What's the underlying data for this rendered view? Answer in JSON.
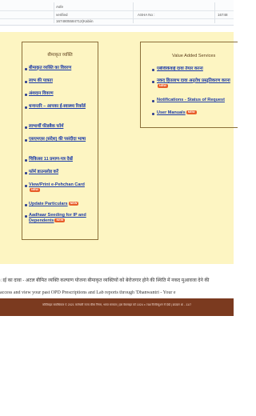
{
  "top_table": {
    "row1_col1": "",
    "row1_col2": "Asfe",
    "row1_col3": "",
    "row2_col1": "",
    "row2_col2": "verified",
    "row2_col3": "ASHA No :",
    "row2_col4": "16748",
    "row3_col2": "1674805584712(Kabiin"
  },
  "left_box": {
    "title": "बीमाकृत व्यक्ति",
    "items": [
      {
        "label": "बीमाकृत व्यक्ति का विवरण"
      },
      {
        "label": "लाभ की पात्रता"
      },
      {
        "label": "अंशदान विवरण"
      },
      {
        "label": "धन्वन्तरि – आपका ई-स्वास्थ्य रिकॉर्ड"
      },
      {
        "label": "लाभार्थी फीडबैक फॉर्म"
      },
      {
        "label": "एसएमएस (संदेश) की पसंदीदा भाषा"
      },
      {
        "label": "चिकित्सा 11 प्रमाण-पत्र देखें"
      },
      {
        "label": "फॉर्म डाउनलोड करें"
      },
      {
        "label": "View/Print e-Pehchan Card",
        "badge": "NEW"
      },
      {
        "label": "Update Particulars",
        "badge": "NEW"
      },
      {
        "label": "Aadhaar Seeding for IP and Dependents",
        "badge": "NEW"
      }
    ]
  },
  "right_box": {
    "title": "Value Added Services",
    "items": [
      {
        "label": "एबीवीकेवाई दावा तैयार करना"
      },
      {
        "label": "नकद हितलाभ दावा अनुरोध प्रस्तुतिकरण करना",
        "badge": "NEW"
      },
      {
        "label": "Notifications - Status of Request"
      },
      {
        "label": "User Manuals",
        "badge": "NEW"
      }
    ]
  },
  "marquee": {
    "line1": "ाई का दावा - अटल बीमित व्यक्ति कल्याण योजना बीमाकृत व्यक्तियों को बेरोजगार होने की स्थिति में नकद मुआवजा देने की",
    "line2": "access and view your past OPD Prescriptions and Lab reports through 'Dhanwantri - Your e"
  },
  "footer": {
    "text": "कॉपीराइट सर्वाधिकार © 2021 कर्मचारी राज्य बीमा निगम, भारत सरकार | इस वेबसाइट को 1024 x 768 रिजॉल्यूशन में देखें | ब्राउज़र IE - 11/7"
  },
  "colors": {
    "panel_bg": "#fdf5c2",
    "link": "#1a3aa8",
    "footer_bg": "#7b3a1f",
    "badge": "#e85d2a"
  }
}
